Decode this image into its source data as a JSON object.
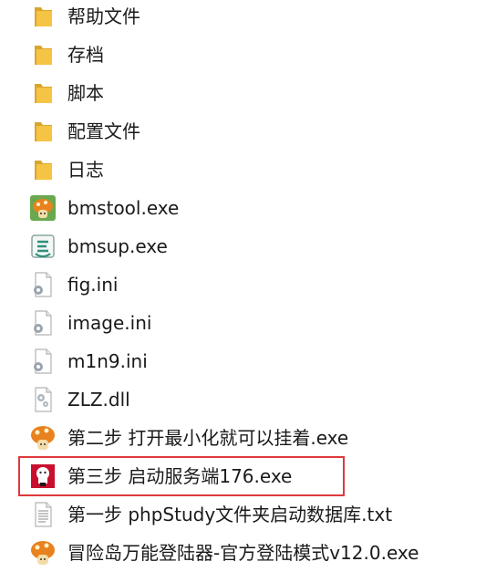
{
  "files": [
    {
      "name": "帮助文件",
      "type": "folder",
      "icon": "folder-icon"
    },
    {
      "name": "存档",
      "type": "folder",
      "icon": "folder-icon"
    },
    {
      "name": "脚本",
      "type": "folder",
      "icon": "folder-icon"
    },
    {
      "name": "配置文件",
      "type": "folder",
      "icon": "folder-icon"
    },
    {
      "name": "日志",
      "type": "folder",
      "icon": "folder-icon"
    },
    {
      "name": "bmstool.exe",
      "type": "exe",
      "icon": "mushroom-app-icon"
    },
    {
      "name": "bmsup.exe",
      "type": "exe",
      "icon": "updater-app-icon"
    },
    {
      "name": "fig.ini",
      "type": "ini",
      "icon": "settings-file-icon"
    },
    {
      "name": "image.ini",
      "type": "ini",
      "icon": "settings-file-icon"
    },
    {
      "name": "m1n9.ini",
      "type": "ini",
      "icon": "settings-file-icon"
    },
    {
      "name": "ZLZ.dll",
      "type": "dll",
      "icon": "dll-file-icon"
    },
    {
      "name": "第二步 打开最小化就可以挂着.exe",
      "type": "exe",
      "icon": "mushroom-app-icon"
    },
    {
      "name": "第三步 启动服务端176.exe",
      "type": "exe",
      "icon": "kfc-app-icon",
      "highlighted": true
    },
    {
      "name": "第一步 phpStudy文件夹启动数据库.txt",
      "type": "txt",
      "icon": "text-file-icon"
    },
    {
      "name": "冒险岛万能登陆器-官方登陆模式v12.0.exe",
      "type": "exe",
      "icon": "mushroom-app-icon"
    }
  ],
  "colors": {
    "highlight_border": "#e0383c",
    "folder": "#f6c445",
    "text": "#1a1a1a"
  }
}
